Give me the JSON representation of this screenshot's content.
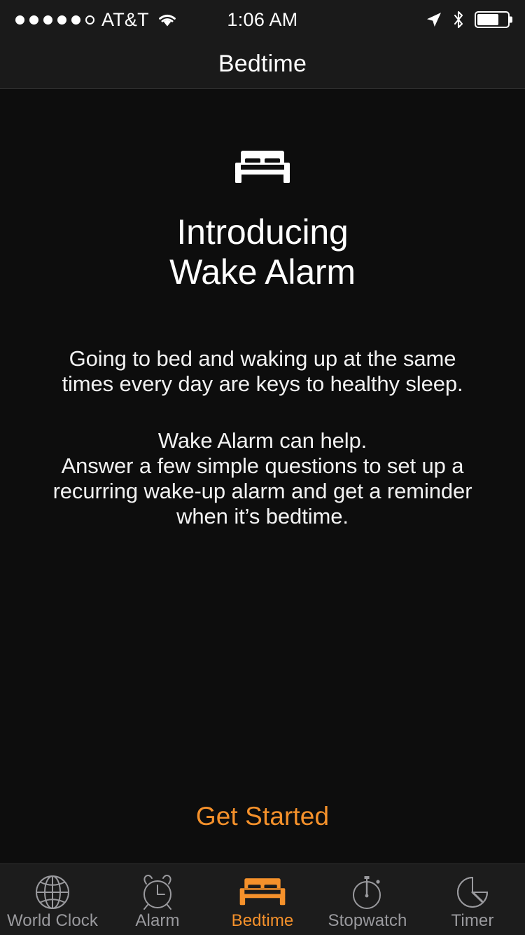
{
  "status_bar": {
    "signal_dots_total": 6,
    "signal_dots_filled": 5,
    "carrier": "AT&T",
    "wifi_icon": "wifi-icon",
    "time": "1:06 AM",
    "location_icon": "location-arrow-icon",
    "bluetooth_icon": "bluetooth-icon",
    "battery_icon": "battery-icon",
    "battery_percent": 72
  },
  "nav": {
    "title": "Bedtime"
  },
  "hero": {
    "icon": "bed-icon",
    "headline": "Introducing\nWake Alarm",
    "paragraphs": [
      "Going to bed and waking up at the same times every day are keys to healthy sleep.",
      "Wake Alarm can help.\nAnswer a few simple questions to set up a recurring wake-up alarm and get a reminder when it’s bedtime."
    ]
  },
  "cta": {
    "label": "Get Started"
  },
  "tabbar": {
    "active_index": 2,
    "items": [
      {
        "label": "World Clock",
        "icon": "globe-icon"
      },
      {
        "label": "Alarm",
        "icon": "alarm-clock-icon"
      },
      {
        "label": "Bedtime",
        "icon": "bed-icon"
      },
      {
        "label": "Stopwatch",
        "icon": "stopwatch-icon"
      },
      {
        "label": "Timer",
        "icon": "timer-icon"
      }
    ]
  },
  "colors": {
    "background": "#0d0d0d",
    "bar_background": "#1a1a1a",
    "tabbar_background": "#1c1c1c",
    "accent_orange": "#f5912b",
    "text_primary": "#ffffff",
    "text_inactive": "#9a9a9e"
  }
}
